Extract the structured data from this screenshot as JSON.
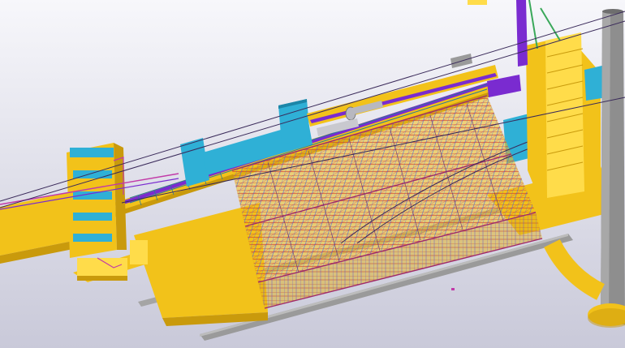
{
  "viewport": {
    "background_top": "#f7f7fb",
    "background_bottom": "#c9c9d9"
  },
  "colors": {
    "steel_yellow": "#f2c21a",
    "steel_yellow_dark": "#c99a0c",
    "steel_yellow_light": "#ffdc4a",
    "equipment_blue": "#2fb0d6",
    "equipment_blue_dark": "#1c86a8",
    "duct_purple": "#7a2bd0",
    "pipe_magenta": "#c23aa8",
    "pipe_green": "#3aa85a",
    "pipe_red": "#d23a2a",
    "concrete_grey": "#9a9a9a",
    "cable_dark": "#3a2a5a",
    "chimney_grey": "#8e8e8e"
  },
  "model": {
    "components": [
      "chimney-stack",
      "boiler-building-frame",
      "left-tower-structure",
      "right-tower-structure",
      "conveyor-gallery",
      "flue-duct",
      "ground-pipe",
      "foundation-slab"
    ]
  }
}
